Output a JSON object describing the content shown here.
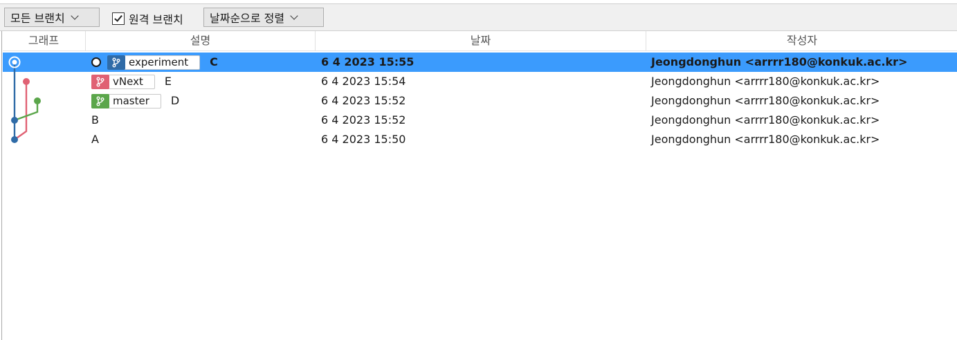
{
  "toolbar": {
    "branch_filter": "모든 브랜치",
    "remote_branches_label": "원격 브랜치",
    "remote_branches_checked": true,
    "sort_order": "날짜순으로 정렬"
  },
  "columns": {
    "graph": "그래프",
    "description": "설명",
    "date": "날짜",
    "author": "작성자"
  },
  "branch_colors": {
    "experiment": "#2f6ba7",
    "vNext": "#e06173",
    "master": "#5ba64b"
  },
  "commits": [
    {
      "tag": "experiment",
      "message": "C",
      "date": "6 4 2023 15:55",
      "author": "Jeongdonghun <arrrr180@konkuk.ac.kr>",
      "selected": true,
      "head": true
    },
    {
      "tag": "vNext",
      "message": "E",
      "date": "6 4 2023 15:54",
      "author": "Jeongdonghun <arrrr180@konkuk.ac.kr>"
    },
    {
      "tag": "master",
      "message": "D",
      "date": "6 4 2023 15:52",
      "author": "Jeongdonghun <arrrr180@konkuk.ac.kr>"
    },
    {
      "message": "B",
      "date": "6 4 2023 15:52",
      "author": "Jeongdonghun <arrrr180@konkuk.ac.kr>"
    },
    {
      "message": "A",
      "date": "6 4 2023 15:50",
      "author": "Jeongdonghun <arrrr180@konkuk.ac.kr>"
    }
  ]
}
